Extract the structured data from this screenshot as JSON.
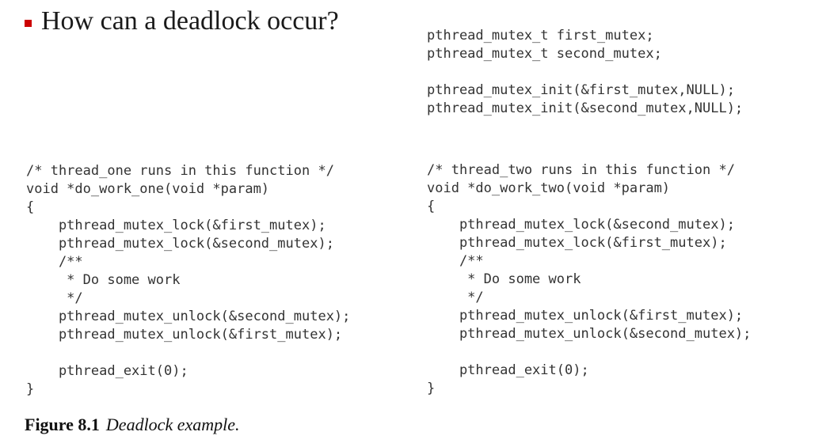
{
  "slide": {
    "bullet_color": "#cc0000",
    "heading": "How can a deadlock occur?"
  },
  "declarations": {
    "code": "pthread_mutex_t first_mutex;\npthread_mutex_t second_mutex;\n\npthread_mutex_init(&first_mutex,NULL);\npthread_mutex_init(&second_mutex,NULL);"
  },
  "thread_one": {
    "code": "/* thread_one runs in this function */\nvoid *do_work_one(void *param)\n{\n    pthread_mutex_lock(&first_mutex);\n    pthread_mutex_lock(&second_mutex);\n    /**\n     * Do some work\n     */\n    pthread_mutex_unlock(&second_mutex);\n    pthread_mutex_unlock(&first_mutex);\n\n    pthread_exit(0);\n}"
  },
  "thread_two": {
    "code": "/* thread_two runs in this function */\nvoid *do_work_two(void *param)\n{\n    pthread_mutex_lock(&second_mutex);\n    pthread_mutex_lock(&first_mutex);\n    /**\n     * Do some work\n     */\n    pthread_mutex_unlock(&first_mutex);\n    pthread_mutex_unlock(&second_mutex);\n\n    pthread_exit(0);\n}"
  },
  "caption": {
    "number": "Figure 8.1",
    "text": "Deadlock example."
  }
}
